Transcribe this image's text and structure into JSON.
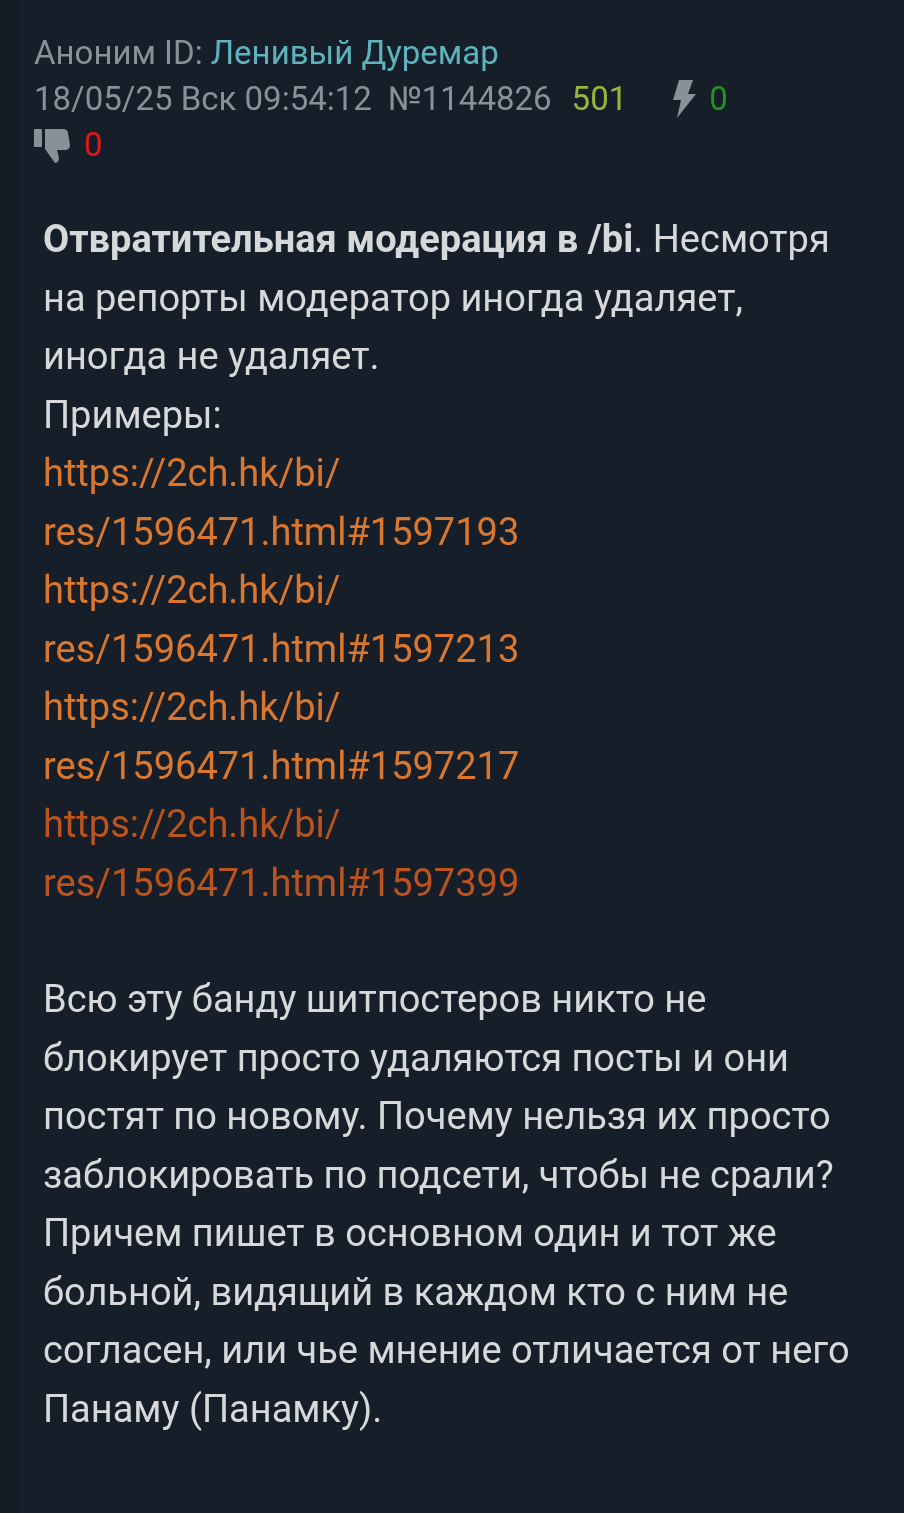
{
  "post": {
    "author_label": "Аноним ID:",
    "author_id": "Ленивый Дуремар",
    "datetime": "18/05/25 Вск 09:54:12",
    "number": "№1144826",
    "counter": "501",
    "likes": "0",
    "dislikes": "0",
    "intro": "**Отвратительная модерация в /bi**. Несмотря на репорты модератор иногда удаляет, иногда не удаляет.",
    "examples_label": "Примеры:",
    "links": [
      {
        "lines": [
          "https://2ch.hk/bi/",
          "res/1596471.html#1597193"
        ],
        "visited": false
      },
      {
        "lines": [
          "https://2ch.hk/bi/",
          "res/1596471.html#1597213"
        ],
        "visited": false
      },
      {
        "lines": [
          "https://2ch.hk/bi/",
          "res/1596471.html#1597217"
        ],
        "visited": false
      },
      {
        "lines": [
          "https://2ch.hk/bi/",
          "res/1596471.html#1597399"
        ],
        "visited": true
      }
    ],
    "body": "Всю эту банду шитпостеров никто не блокирует просто удаляются посты и они постят по новому. Почему нельзя их просто заблокировать по подсети, чтобы не срали? Причем пишет в основном один и тот же больной, видящий в каждом кто с ним не согласен, или чье мнение отличается от него Панаму (Панамку)."
  }
}
